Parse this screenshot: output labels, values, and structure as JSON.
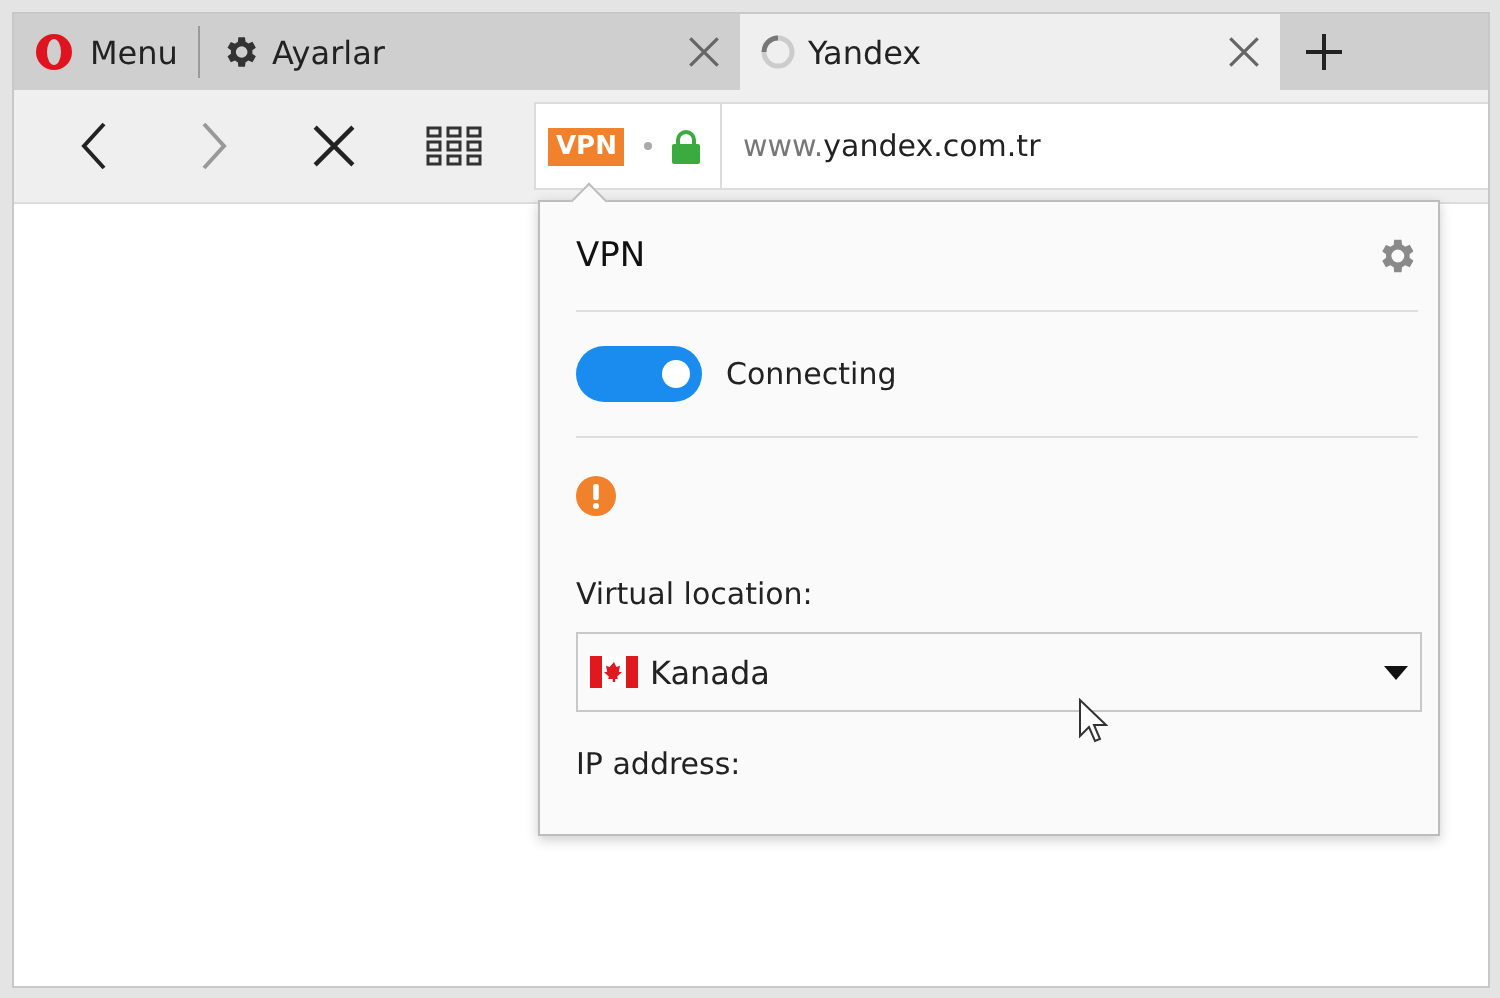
{
  "menu": {
    "label": "Menu"
  },
  "tabs": [
    {
      "label": "Ayarlar",
      "kind": "settings",
      "selected": false
    },
    {
      "label": "Yandex",
      "kind": "loading",
      "selected": true
    }
  ],
  "toolbar": {
    "back_disabled": false,
    "forward_disabled": true
  },
  "address_bar": {
    "badge": "VPN",
    "secure": true,
    "url_prefix": "www.",
    "url_host": "yandex.com.tr"
  },
  "vpn_popup": {
    "title": "VPN",
    "toggle": {
      "on": true,
      "label": "Connecting"
    },
    "warning": true,
    "location_label": "Virtual location:",
    "location": {
      "value": "Kanada"
    },
    "ip_label": "IP address:"
  }
}
